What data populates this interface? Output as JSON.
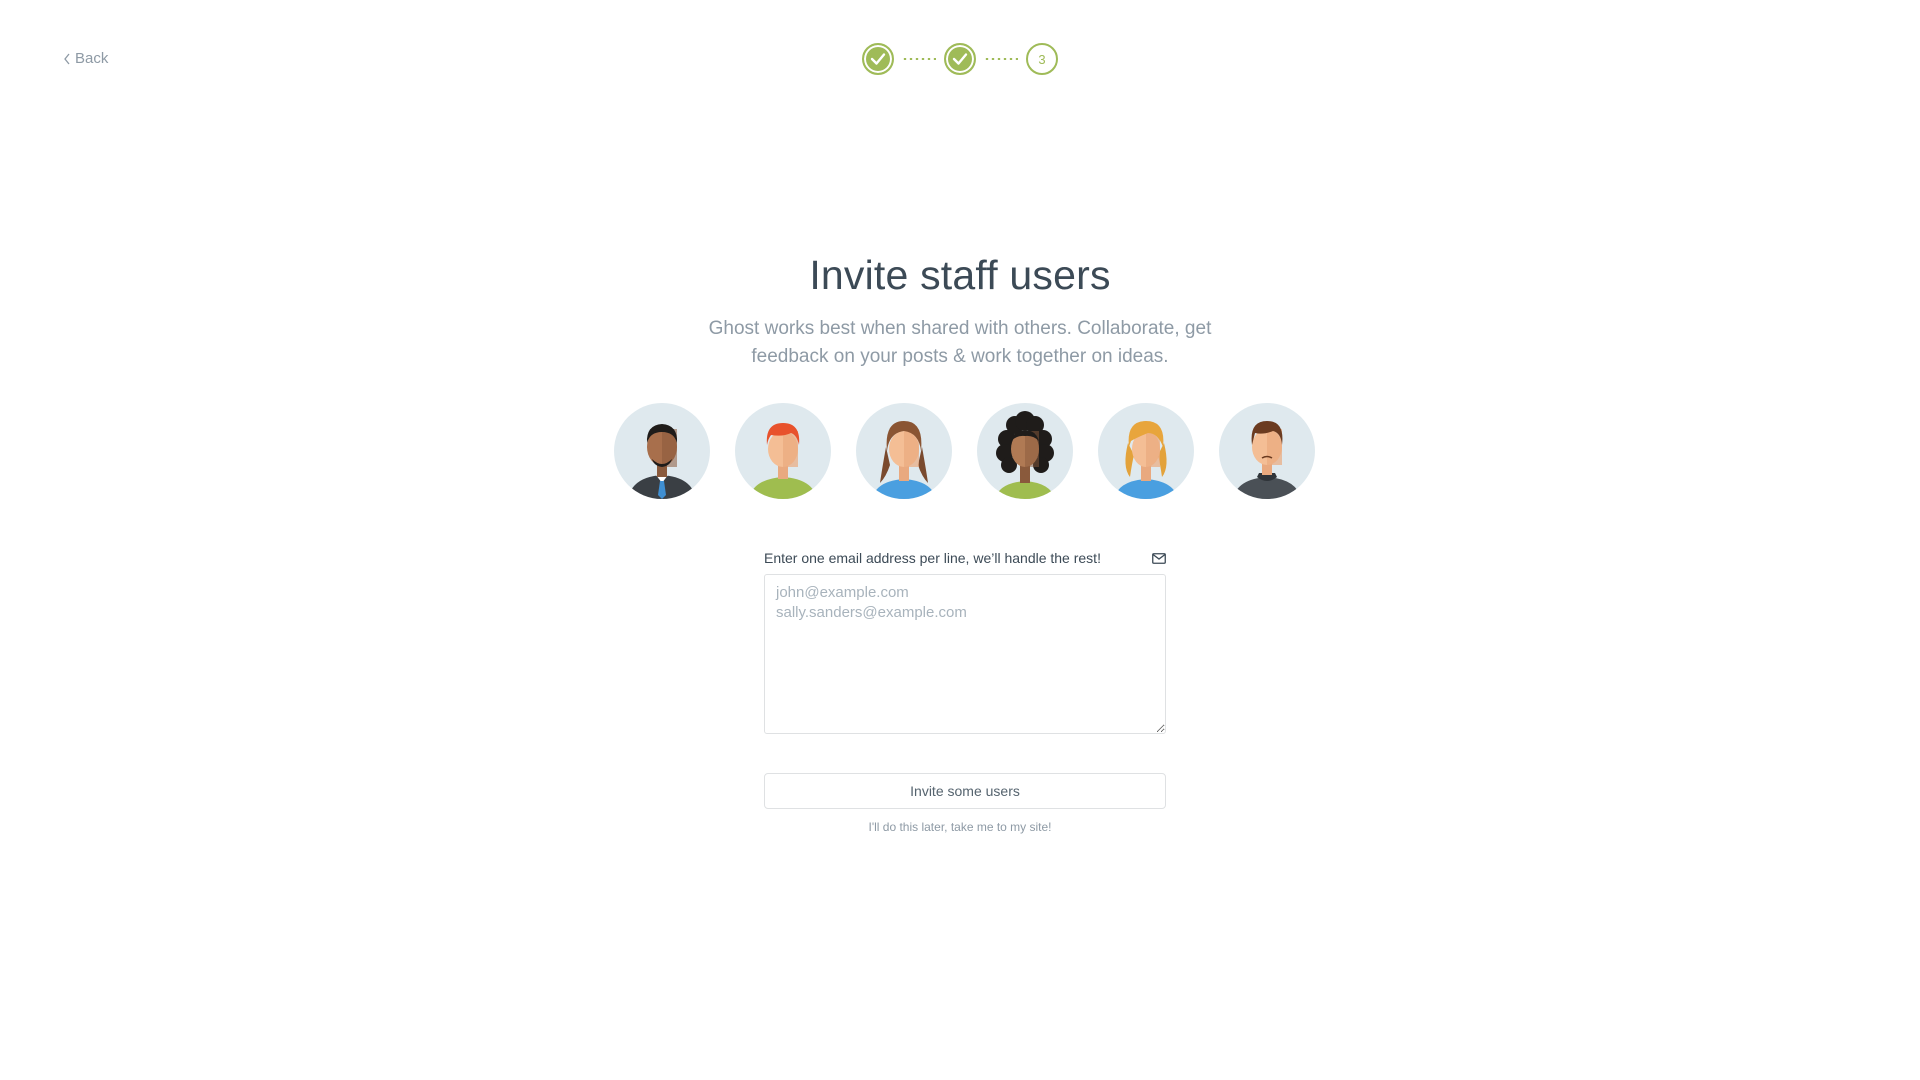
{
  "nav": {
    "back_label": "Back"
  },
  "steps": {
    "items": [
      {
        "state": "done",
        "label": ""
      },
      {
        "state": "done",
        "label": ""
      },
      {
        "state": "current",
        "label": "3"
      }
    ],
    "accent_color": "#9fbb58"
  },
  "content": {
    "title": "Invite staff users",
    "subtitle": "Ghost works best when shared with others. Collaborate, get feedback on your posts & work together on ideas."
  },
  "avatars": [
    {
      "icon": "man-dark-skin-tie-avatar-icon"
    },
    {
      "icon": "person-red-hair-avatar-icon"
    },
    {
      "icon": "woman-brown-pigtails-avatar-icon"
    },
    {
      "icon": "woman-curly-hair-avatar-icon"
    },
    {
      "icon": "woman-blonde-hair-avatar-icon"
    },
    {
      "icon": "man-brown-hair-avatar-icon"
    }
  ],
  "form": {
    "label": "Enter one email address per line, we’ll handle the rest!",
    "label_icon": "envelope-icon",
    "emails_value": "",
    "emails_placeholder": "john@example.com\nsally.sanders@example.com",
    "submit_label": "Invite some users",
    "skip_label": "I'll do this later, take me to my site!"
  }
}
